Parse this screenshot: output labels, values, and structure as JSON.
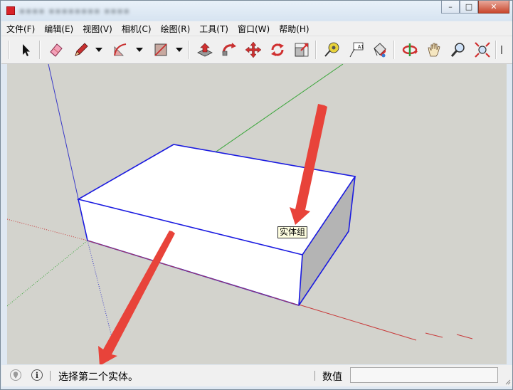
{
  "window": {
    "title": "▪▪▪▪ ▪▪▪▪▪▪▪▪ ▪▪▪▪",
    "minimize_label": "–",
    "maximize_label": "□",
    "close_label": "✕"
  },
  "menubar": {
    "items": [
      "文件(F)",
      "编辑(E)",
      "视图(V)",
      "相机(C)",
      "绘图(R)",
      "工具(T)",
      "窗口(W)",
      "帮助(H)"
    ]
  },
  "toolbar": {
    "tools": [
      "select-icon",
      "eraser-icon",
      "pencil-icon",
      "arc-icon",
      "rectangle-icon",
      "push-pull-icon",
      "follow-me-icon",
      "move-icon",
      "rotate-icon",
      "scale-icon",
      "tape-measure-icon",
      "text-icon",
      "paint-bucket-icon",
      "orbit-icon",
      "pan-icon",
      "zoom-icon",
      "zoom-extents-icon"
    ],
    "text_tool_label": "A1"
  },
  "viewport": {
    "tooltip": "实体组",
    "colors": {
      "background": "#d3d3cd",
      "axis_red": "#c83a3a",
      "axis_green": "#3aa63a",
      "axis_blue": "#3a3ac8",
      "selection": "#1a1ae0",
      "arrow": "#e8433a"
    }
  },
  "statusbar": {
    "message": "选择第二个实体。",
    "measurements_label": "数值",
    "measurements_value": ""
  }
}
